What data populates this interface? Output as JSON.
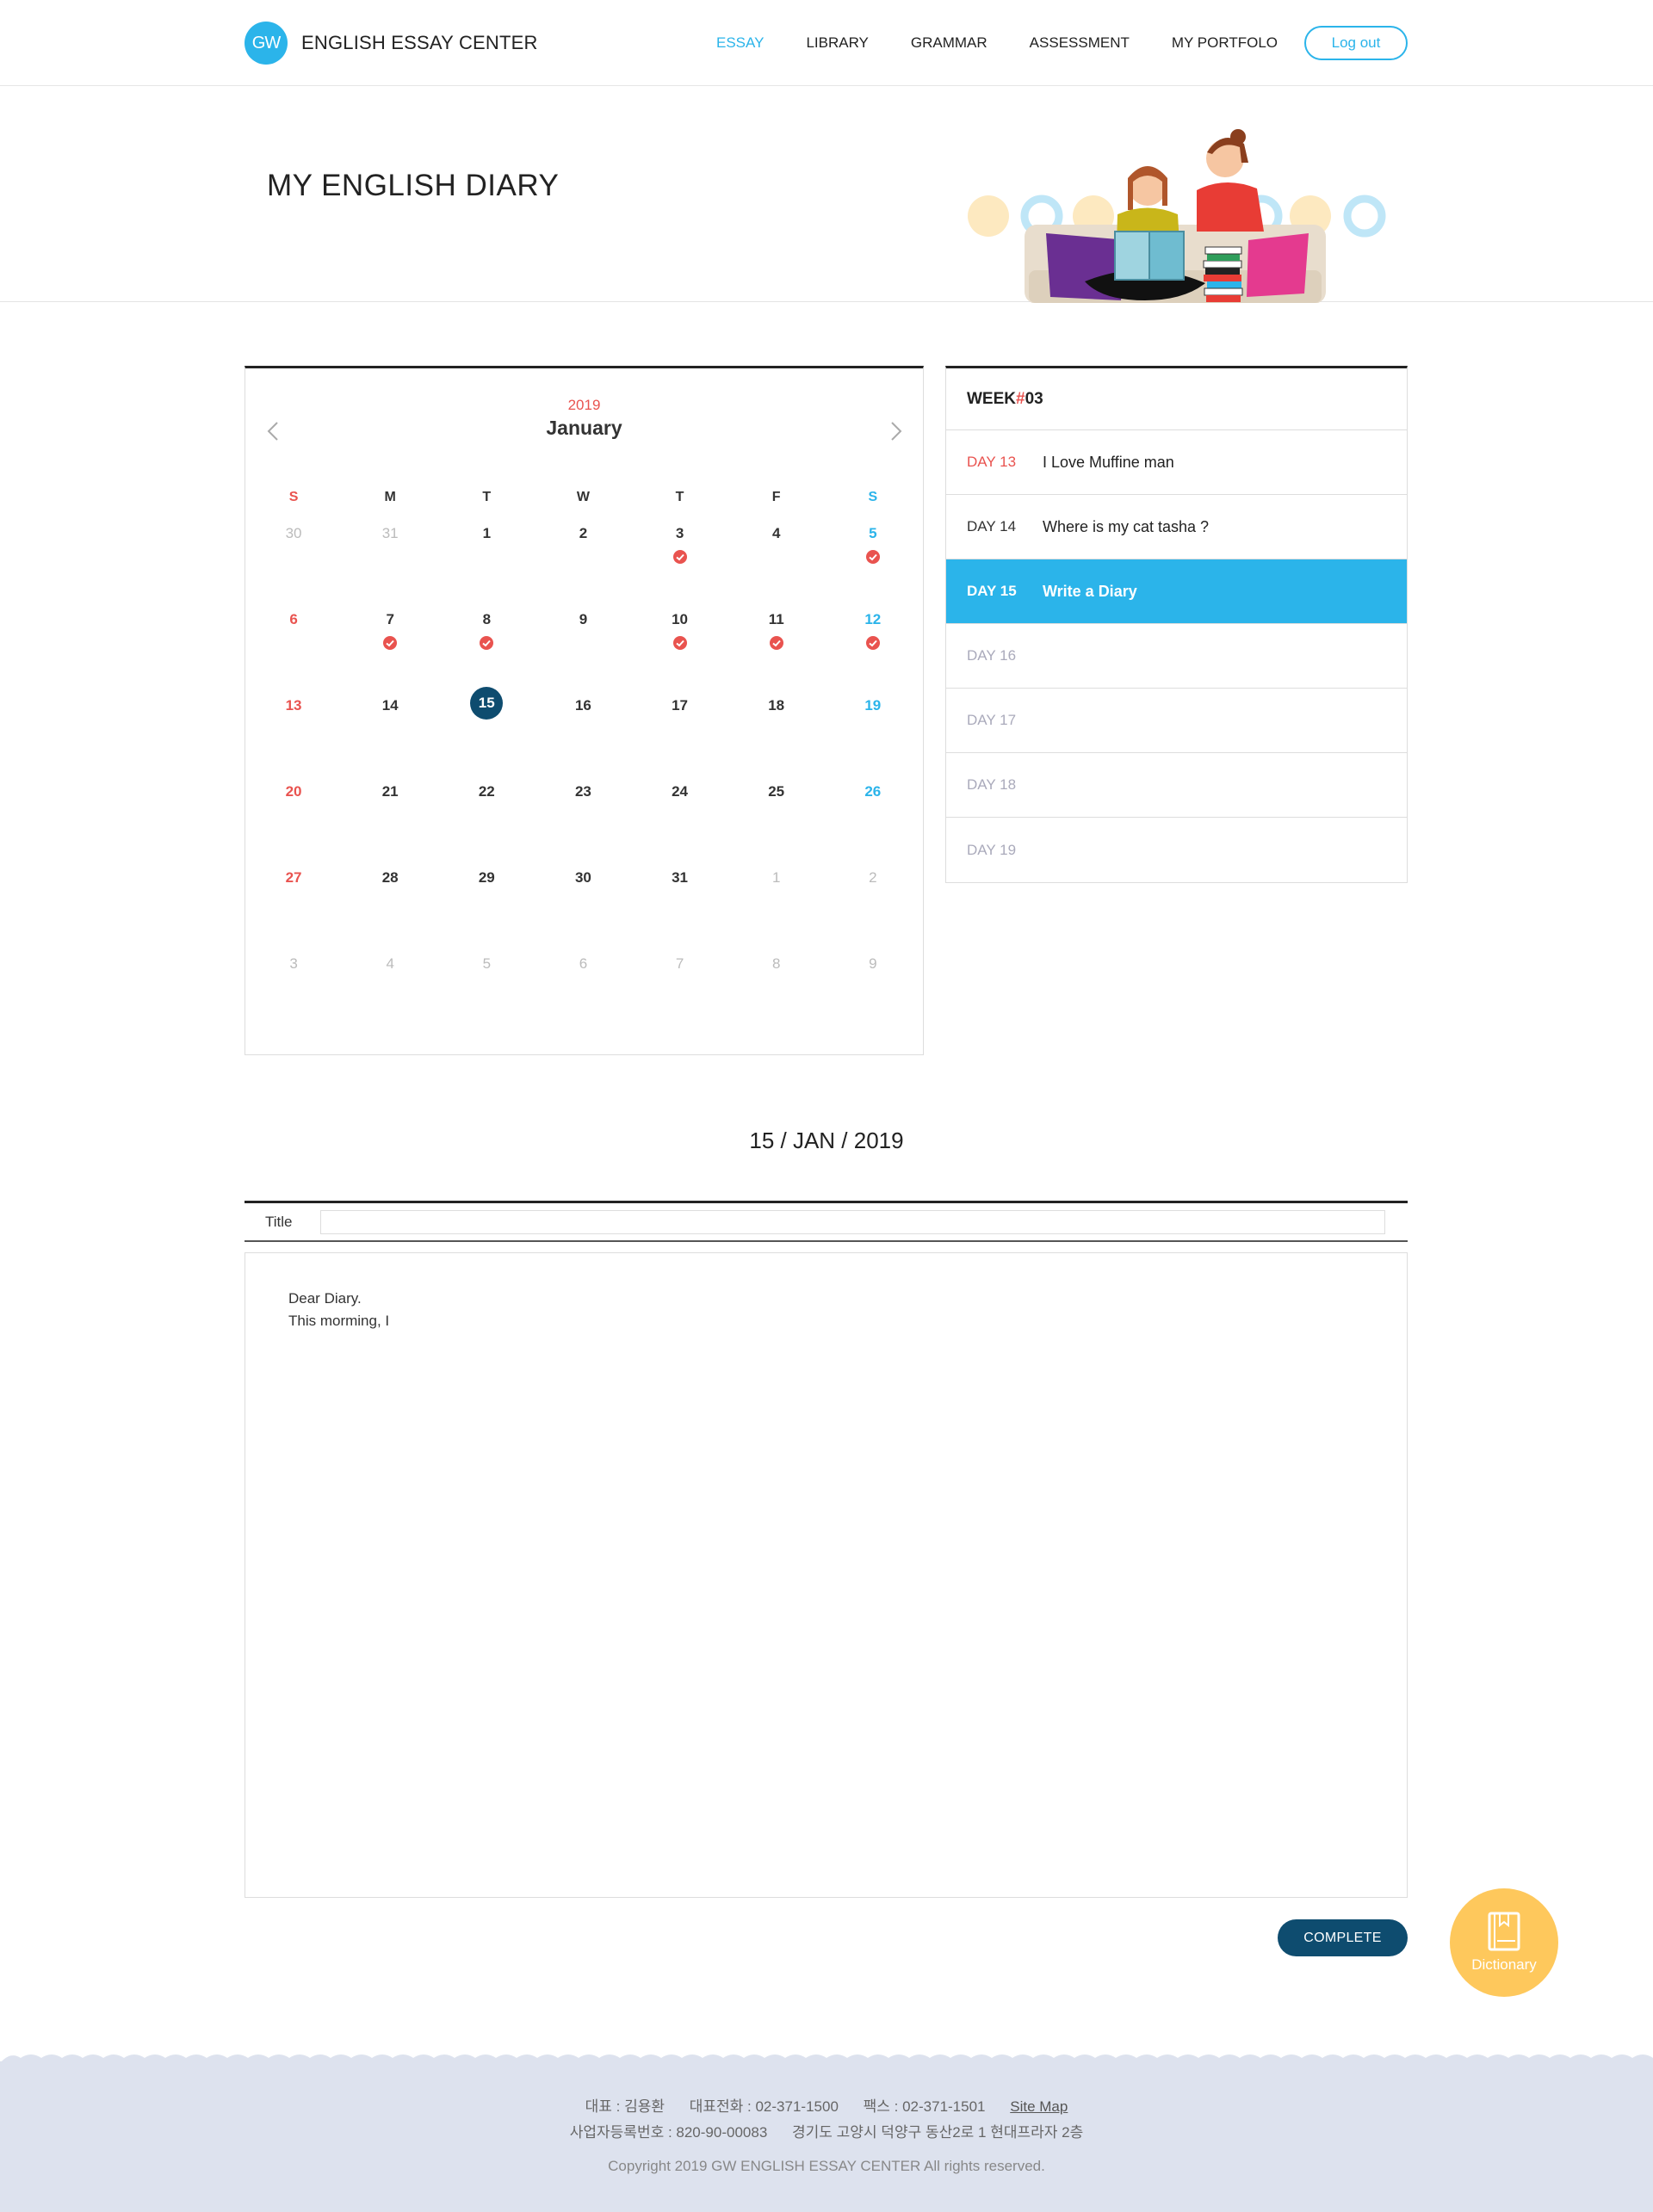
{
  "header": {
    "logo_mark": "GW",
    "logo_text": "ENGLISH ESSAY CENTER",
    "nav": [
      "ESSAY",
      "LIBRARY",
      "GRAMMAR",
      "ASSESSMENT",
      "MY PORTFOLO"
    ],
    "active_nav": "ESSAY",
    "logout_label": "Log out"
  },
  "hero": {
    "title": "MY ENGLISH DIARY"
  },
  "calendar": {
    "year": "2019",
    "month": "January",
    "weekdays": [
      "S",
      "M",
      "T",
      "W",
      "T",
      "F",
      "S"
    ],
    "weeks": [
      [
        {
          "d": "30",
          "other": true
        },
        {
          "d": "31",
          "other": true
        },
        {
          "d": "1"
        },
        {
          "d": "2"
        },
        {
          "d": "3",
          "check": true
        },
        {
          "d": "4"
        },
        {
          "d": "5",
          "check": true
        }
      ],
      [
        {
          "d": "6"
        },
        {
          "d": "7",
          "check": true
        },
        {
          "d": "8",
          "check": true
        },
        {
          "d": "9"
        },
        {
          "d": "10",
          "check": true
        },
        {
          "d": "11",
          "check": true
        },
        {
          "d": "12",
          "check": true
        }
      ],
      [
        {
          "d": "13"
        },
        {
          "d": "14"
        },
        {
          "d": "15",
          "today": true
        },
        {
          "d": "16"
        },
        {
          "d": "17"
        },
        {
          "d": "18"
        },
        {
          "d": "19"
        }
      ],
      [
        {
          "d": "20"
        },
        {
          "d": "21"
        },
        {
          "d": "22"
        },
        {
          "d": "23"
        },
        {
          "d": "24"
        },
        {
          "d": "25"
        },
        {
          "d": "26"
        }
      ],
      [
        {
          "d": "27"
        },
        {
          "d": "28"
        },
        {
          "d": "29"
        },
        {
          "d": "30"
        },
        {
          "d": "31"
        },
        {
          "d": "1",
          "other": true
        },
        {
          "d": "2",
          "other": true
        }
      ],
      [
        {
          "d": "3",
          "other": true
        },
        {
          "d": "4",
          "other": true
        },
        {
          "d": "5",
          "other": true
        },
        {
          "d": "6",
          "other": true
        },
        {
          "d": "7",
          "other": true
        },
        {
          "d": "8",
          "other": true
        },
        {
          "d": "9",
          "other": true
        }
      ]
    ]
  },
  "week": {
    "title_prefix": "WEEK ",
    "title_hash": "#",
    "title_num": "03",
    "days": [
      {
        "label": "DAY 13",
        "text": "I Love Muffine man",
        "state": "red"
      },
      {
        "label": "DAY 14",
        "text": "Where is my cat tasha ?",
        "state": "normal"
      },
      {
        "label": "DAY 15",
        "text": "Write a Diary",
        "state": "active"
      },
      {
        "label": "DAY 16",
        "text": "",
        "state": "muted"
      },
      {
        "label": "DAY 17",
        "text": "",
        "state": "muted"
      },
      {
        "label": "DAY 18",
        "text": "",
        "state": "muted"
      },
      {
        "label": "DAY 19",
        "text": "",
        "state": "muted"
      }
    ]
  },
  "entry": {
    "date_heading": "15 / JAN / 2019",
    "title_label": "Title",
    "title_value": "",
    "body_text": "Dear Diary.\nThis morming, I",
    "complete_label": "COMPLETE"
  },
  "dictionary": {
    "label": "Dictionary"
  },
  "footer": {
    "ceo": "대표 : 김용환",
    "tel": "대표전화 : 02-371-1500",
    "fax": "팩스 : 02-371-1501",
    "sitemap": "Site Map",
    "biz_no": "사업자등록번호 : 820-90-00083",
    "address": "경기도 고양시 덕양구 동산2로 1 현대프라자 2층",
    "copyright": "Copyright 2019 GW ENGLISH ESSAY CENTER All rights reserved."
  },
  "colors": {
    "accent": "#2bb4ea",
    "navy": "#0e4c6f",
    "red": "#e9534f",
    "yellow": "#fec85c",
    "footer_bg": "#dde2ee"
  }
}
